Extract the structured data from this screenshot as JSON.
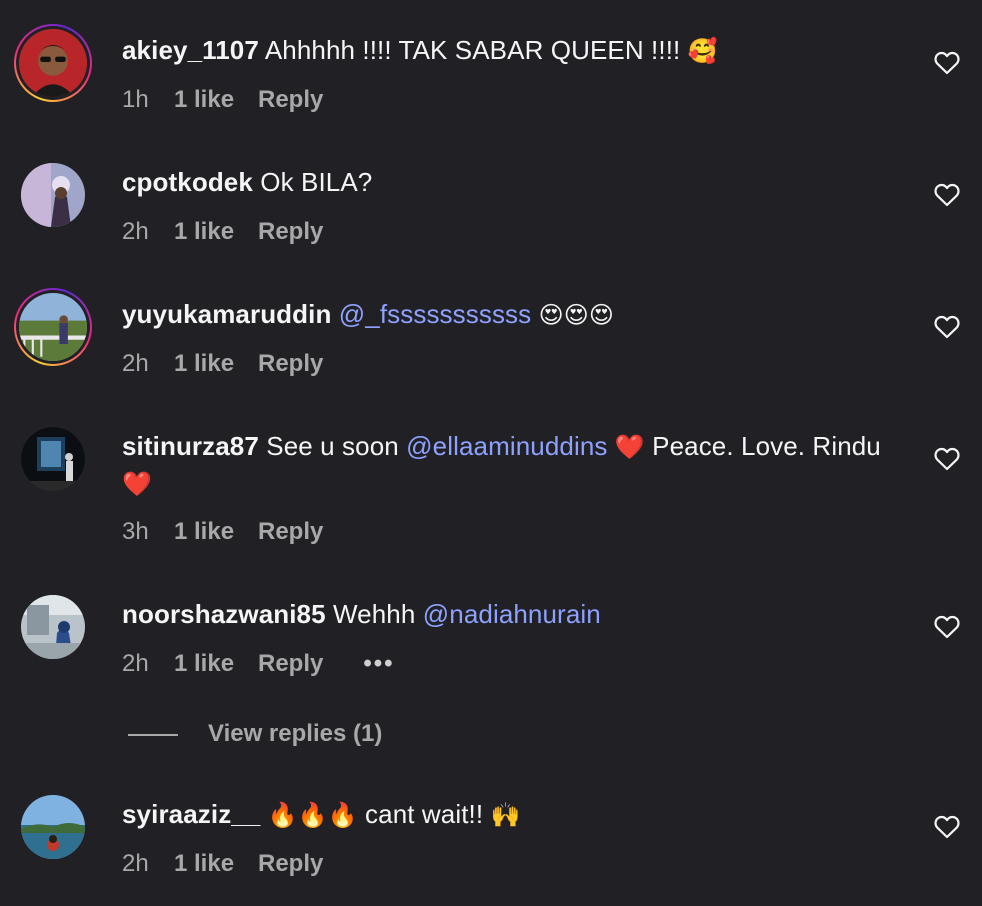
{
  "comments": [
    {
      "username": "akiey_1107",
      "text": "Ahhhhh !!!! TAK SABAR QUEEN !!!!",
      "emoji": "🥰",
      "time": "1h",
      "likes": "1 like",
      "reply": "Reply"
    },
    {
      "username": "cpotkodek",
      "text": "Ok BILA?",
      "time": "2h",
      "likes": "1 like",
      "reply": "Reply"
    },
    {
      "username": "yuyukamaruddin",
      "mention": "@_fsssssssssss",
      "emoji": "😍😍😍",
      "time": "2h",
      "likes": "1 like",
      "reply": "Reply"
    },
    {
      "username": "sitinurza87",
      "text_before": "See u soon",
      "mention": "@ellaaminuddins",
      "emoji_1": "❤️",
      "text_after": "Peace. Love. Rindu",
      "emoji_2": "❤️",
      "time": "3h",
      "likes": "1 like",
      "reply": "Reply"
    },
    {
      "username": "noorshazwani85",
      "text": "Wehhh",
      "mention": "@nadiahnurain",
      "time": "2h",
      "likes": "1 like",
      "reply": "Reply",
      "more": "•••"
    },
    {
      "username": "syiraaziz__",
      "emoji_fire": "🔥🔥🔥",
      "text": "cant wait!!",
      "emoji_hands": "🙌",
      "time": "2h",
      "likes": "1 like",
      "reply": "Reply"
    }
  ],
  "view_replies": "View replies (1)",
  "icons": {
    "like": "heart-outline-icon",
    "more": "more-options-icon"
  },
  "colors": {
    "background": "#212125",
    "text": "#f5f5f5",
    "meta": "#a8a8a8",
    "mention": "#8ea1ff"
  }
}
